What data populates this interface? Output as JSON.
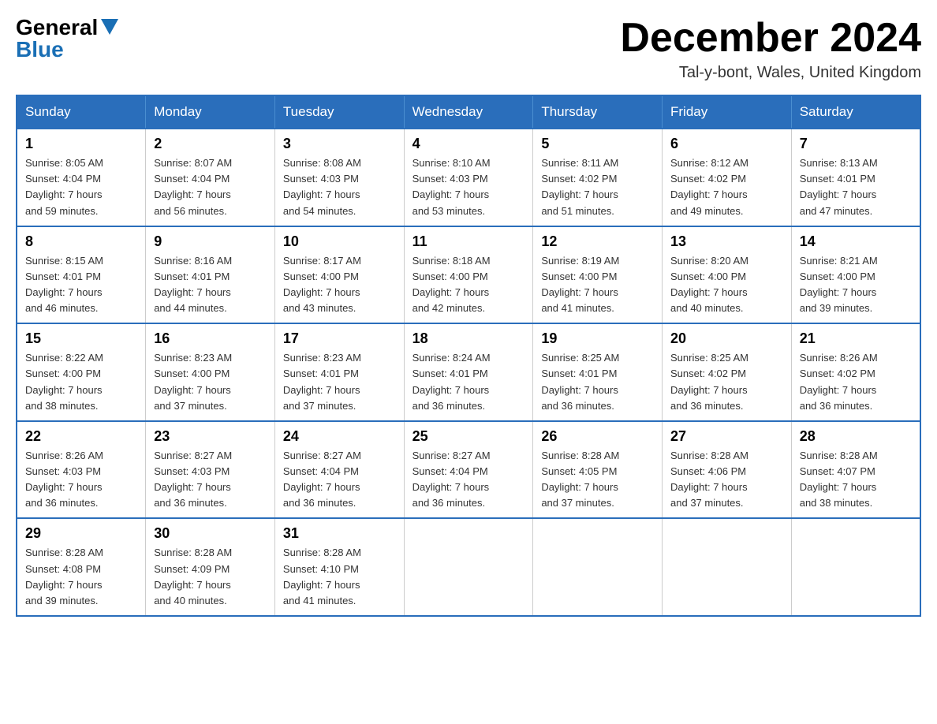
{
  "header": {
    "logo_general": "General",
    "logo_blue": "Blue",
    "month_title": "December 2024",
    "location": "Tal-y-bont, Wales, United Kingdom"
  },
  "weekdays": [
    "Sunday",
    "Monday",
    "Tuesday",
    "Wednesday",
    "Thursday",
    "Friday",
    "Saturday"
  ],
  "weeks": [
    [
      {
        "day": 1,
        "sunrise": "8:05 AM",
        "sunset": "4:04 PM",
        "daylight": "7 hours and 59 minutes."
      },
      {
        "day": 2,
        "sunrise": "8:07 AM",
        "sunset": "4:04 PM",
        "daylight": "7 hours and 56 minutes."
      },
      {
        "day": 3,
        "sunrise": "8:08 AM",
        "sunset": "4:03 PM",
        "daylight": "7 hours and 54 minutes."
      },
      {
        "day": 4,
        "sunrise": "8:10 AM",
        "sunset": "4:03 PM",
        "daylight": "7 hours and 53 minutes."
      },
      {
        "day": 5,
        "sunrise": "8:11 AM",
        "sunset": "4:02 PM",
        "daylight": "7 hours and 51 minutes."
      },
      {
        "day": 6,
        "sunrise": "8:12 AM",
        "sunset": "4:02 PM",
        "daylight": "7 hours and 49 minutes."
      },
      {
        "day": 7,
        "sunrise": "8:13 AM",
        "sunset": "4:01 PM",
        "daylight": "7 hours and 47 minutes."
      }
    ],
    [
      {
        "day": 8,
        "sunrise": "8:15 AM",
        "sunset": "4:01 PM",
        "daylight": "7 hours and 46 minutes."
      },
      {
        "day": 9,
        "sunrise": "8:16 AM",
        "sunset": "4:01 PM",
        "daylight": "7 hours and 44 minutes."
      },
      {
        "day": 10,
        "sunrise": "8:17 AM",
        "sunset": "4:00 PM",
        "daylight": "7 hours and 43 minutes."
      },
      {
        "day": 11,
        "sunrise": "8:18 AM",
        "sunset": "4:00 PM",
        "daylight": "7 hours and 42 minutes."
      },
      {
        "day": 12,
        "sunrise": "8:19 AM",
        "sunset": "4:00 PM",
        "daylight": "7 hours and 41 minutes."
      },
      {
        "day": 13,
        "sunrise": "8:20 AM",
        "sunset": "4:00 PM",
        "daylight": "7 hours and 40 minutes."
      },
      {
        "day": 14,
        "sunrise": "8:21 AM",
        "sunset": "4:00 PM",
        "daylight": "7 hours and 39 minutes."
      }
    ],
    [
      {
        "day": 15,
        "sunrise": "8:22 AM",
        "sunset": "4:00 PM",
        "daylight": "7 hours and 38 minutes."
      },
      {
        "day": 16,
        "sunrise": "8:23 AM",
        "sunset": "4:00 PM",
        "daylight": "7 hours and 37 minutes."
      },
      {
        "day": 17,
        "sunrise": "8:23 AM",
        "sunset": "4:01 PM",
        "daylight": "7 hours and 37 minutes."
      },
      {
        "day": 18,
        "sunrise": "8:24 AM",
        "sunset": "4:01 PM",
        "daylight": "7 hours and 36 minutes."
      },
      {
        "day": 19,
        "sunrise": "8:25 AM",
        "sunset": "4:01 PM",
        "daylight": "7 hours and 36 minutes."
      },
      {
        "day": 20,
        "sunrise": "8:25 AM",
        "sunset": "4:02 PM",
        "daylight": "7 hours and 36 minutes."
      },
      {
        "day": 21,
        "sunrise": "8:26 AM",
        "sunset": "4:02 PM",
        "daylight": "7 hours and 36 minutes."
      }
    ],
    [
      {
        "day": 22,
        "sunrise": "8:26 AM",
        "sunset": "4:03 PM",
        "daylight": "7 hours and 36 minutes."
      },
      {
        "day": 23,
        "sunrise": "8:27 AM",
        "sunset": "4:03 PM",
        "daylight": "7 hours and 36 minutes."
      },
      {
        "day": 24,
        "sunrise": "8:27 AM",
        "sunset": "4:04 PM",
        "daylight": "7 hours and 36 minutes."
      },
      {
        "day": 25,
        "sunrise": "8:27 AM",
        "sunset": "4:04 PM",
        "daylight": "7 hours and 36 minutes."
      },
      {
        "day": 26,
        "sunrise": "8:28 AM",
        "sunset": "4:05 PM",
        "daylight": "7 hours and 37 minutes."
      },
      {
        "day": 27,
        "sunrise": "8:28 AM",
        "sunset": "4:06 PM",
        "daylight": "7 hours and 37 minutes."
      },
      {
        "day": 28,
        "sunrise": "8:28 AM",
        "sunset": "4:07 PM",
        "daylight": "7 hours and 38 minutes."
      }
    ],
    [
      {
        "day": 29,
        "sunrise": "8:28 AM",
        "sunset": "4:08 PM",
        "daylight": "7 hours and 39 minutes."
      },
      {
        "day": 30,
        "sunrise": "8:28 AM",
        "sunset": "4:09 PM",
        "daylight": "7 hours and 40 minutes."
      },
      {
        "day": 31,
        "sunrise": "8:28 AM",
        "sunset": "4:10 PM",
        "daylight": "7 hours and 41 minutes."
      },
      null,
      null,
      null,
      null
    ]
  ],
  "labels": {
    "sunrise": "Sunrise:",
    "sunset": "Sunset:",
    "daylight": "Daylight:"
  }
}
